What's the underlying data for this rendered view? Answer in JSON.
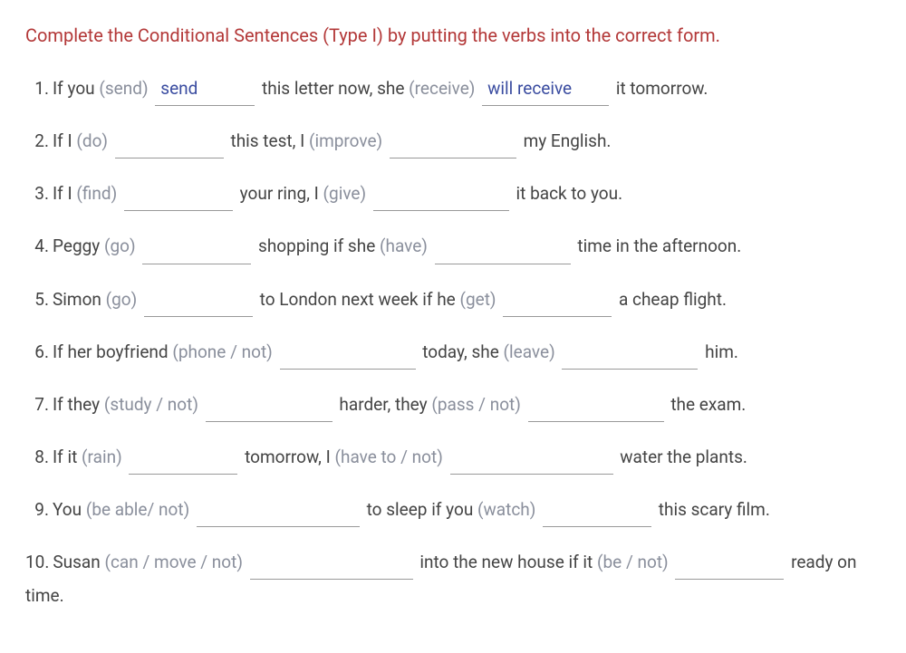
{
  "instruction": "Complete the Conditional Sentences (Type I) by putting the verbs into the correct form.",
  "questions": [
    {
      "num": "1.",
      "parts": [
        "If you ",
        "(send)",
        " ",
        {
          "blank": "send",
          "w": "w-110"
        },
        " this letter now, she ",
        "(receive)",
        " ",
        {
          "blank": "will receive",
          "w": "w-140"
        },
        " it tomorrow."
      ]
    },
    {
      "num": "2.",
      "parts": [
        "If I ",
        "(do)",
        " ",
        {
          "blank": "",
          "w": ""
        },
        " this test, I ",
        "(improve)",
        " ",
        {
          "blank": "",
          "w": "w-140"
        },
        " my English."
      ]
    },
    {
      "num": "3.",
      "parts": [
        "If I ",
        "(find)",
        " ",
        {
          "blank": "",
          "w": ""
        },
        " your ring, I ",
        "(give)",
        " ",
        {
          "blank": "",
          "w": "w-150"
        },
        " it back to you."
      ]
    },
    {
      "num": "4.",
      "parts": [
        "Peggy ",
        "(go)",
        " ",
        {
          "blank": "",
          "w": ""
        },
        " shopping if she ",
        "(have)",
        " ",
        {
          "blank": "",
          "w": "w-150"
        },
        " time in the afternoon."
      ]
    },
    {
      "num": "5.",
      "parts": [
        "Simon ",
        "(go)",
        " ",
        {
          "blank": "",
          "w": ""
        },
        " to London next week if he ",
        "(get)",
        " ",
        {
          "blank": "",
          "w": ""
        },
        " a cheap flight."
      ]
    },
    {
      "num": "6.",
      "parts": [
        "If her boyfriend ",
        "(phone / not)",
        " ",
        {
          "blank": "",
          "w": "w-150"
        },
        " today, she ",
        "(leave)",
        " ",
        {
          "blank": "",
          "w": "w-150"
        },
        " him."
      ]
    },
    {
      "num": "7.",
      "parts": [
        "If they ",
        "(study / not)",
        " ",
        {
          "blank": "",
          "w": "w-140"
        },
        " harder, they ",
        "(pass / not)",
        " ",
        {
          "blank": "",
          "w": "w-150"
        },
        " the exam."
      ]
    },
    {
      "num": "8.",
      "parts": [
        "If it ",
        "(rain)",
        " ",
        {
          "blank": "",
          "w": ""
        },
        " tomorrow, I ",
        "(have to / not)",
        " ",
        {
          "blank": "",
          "w": "w-180"
        },
        " water the plants."
      ]
    },
    {
      "num": "9.",
      "parts": [
        "You ",
        "(be able/ not)",
        " ",
        {
          "blank": "",
          "w": "w-180"
        },
        " to sleep if you ",
        "(watch)",
        " ",
        {
          "blank": "",
          "w": ""
        },
        " this scary film."
      ]
    },
    {
      "num": "10.",
      "parts": [
        "Susan ",
        "(can / move / not)",
        " ",
        {
          "blank": "",
          "w": "w-180"
        },
        " into the new house if it ",
        "(be / not)",
        " ",
        {
          "blank": "",
          "w": ""
        },
        " ready on time."
      ]
    }
  ]
}
